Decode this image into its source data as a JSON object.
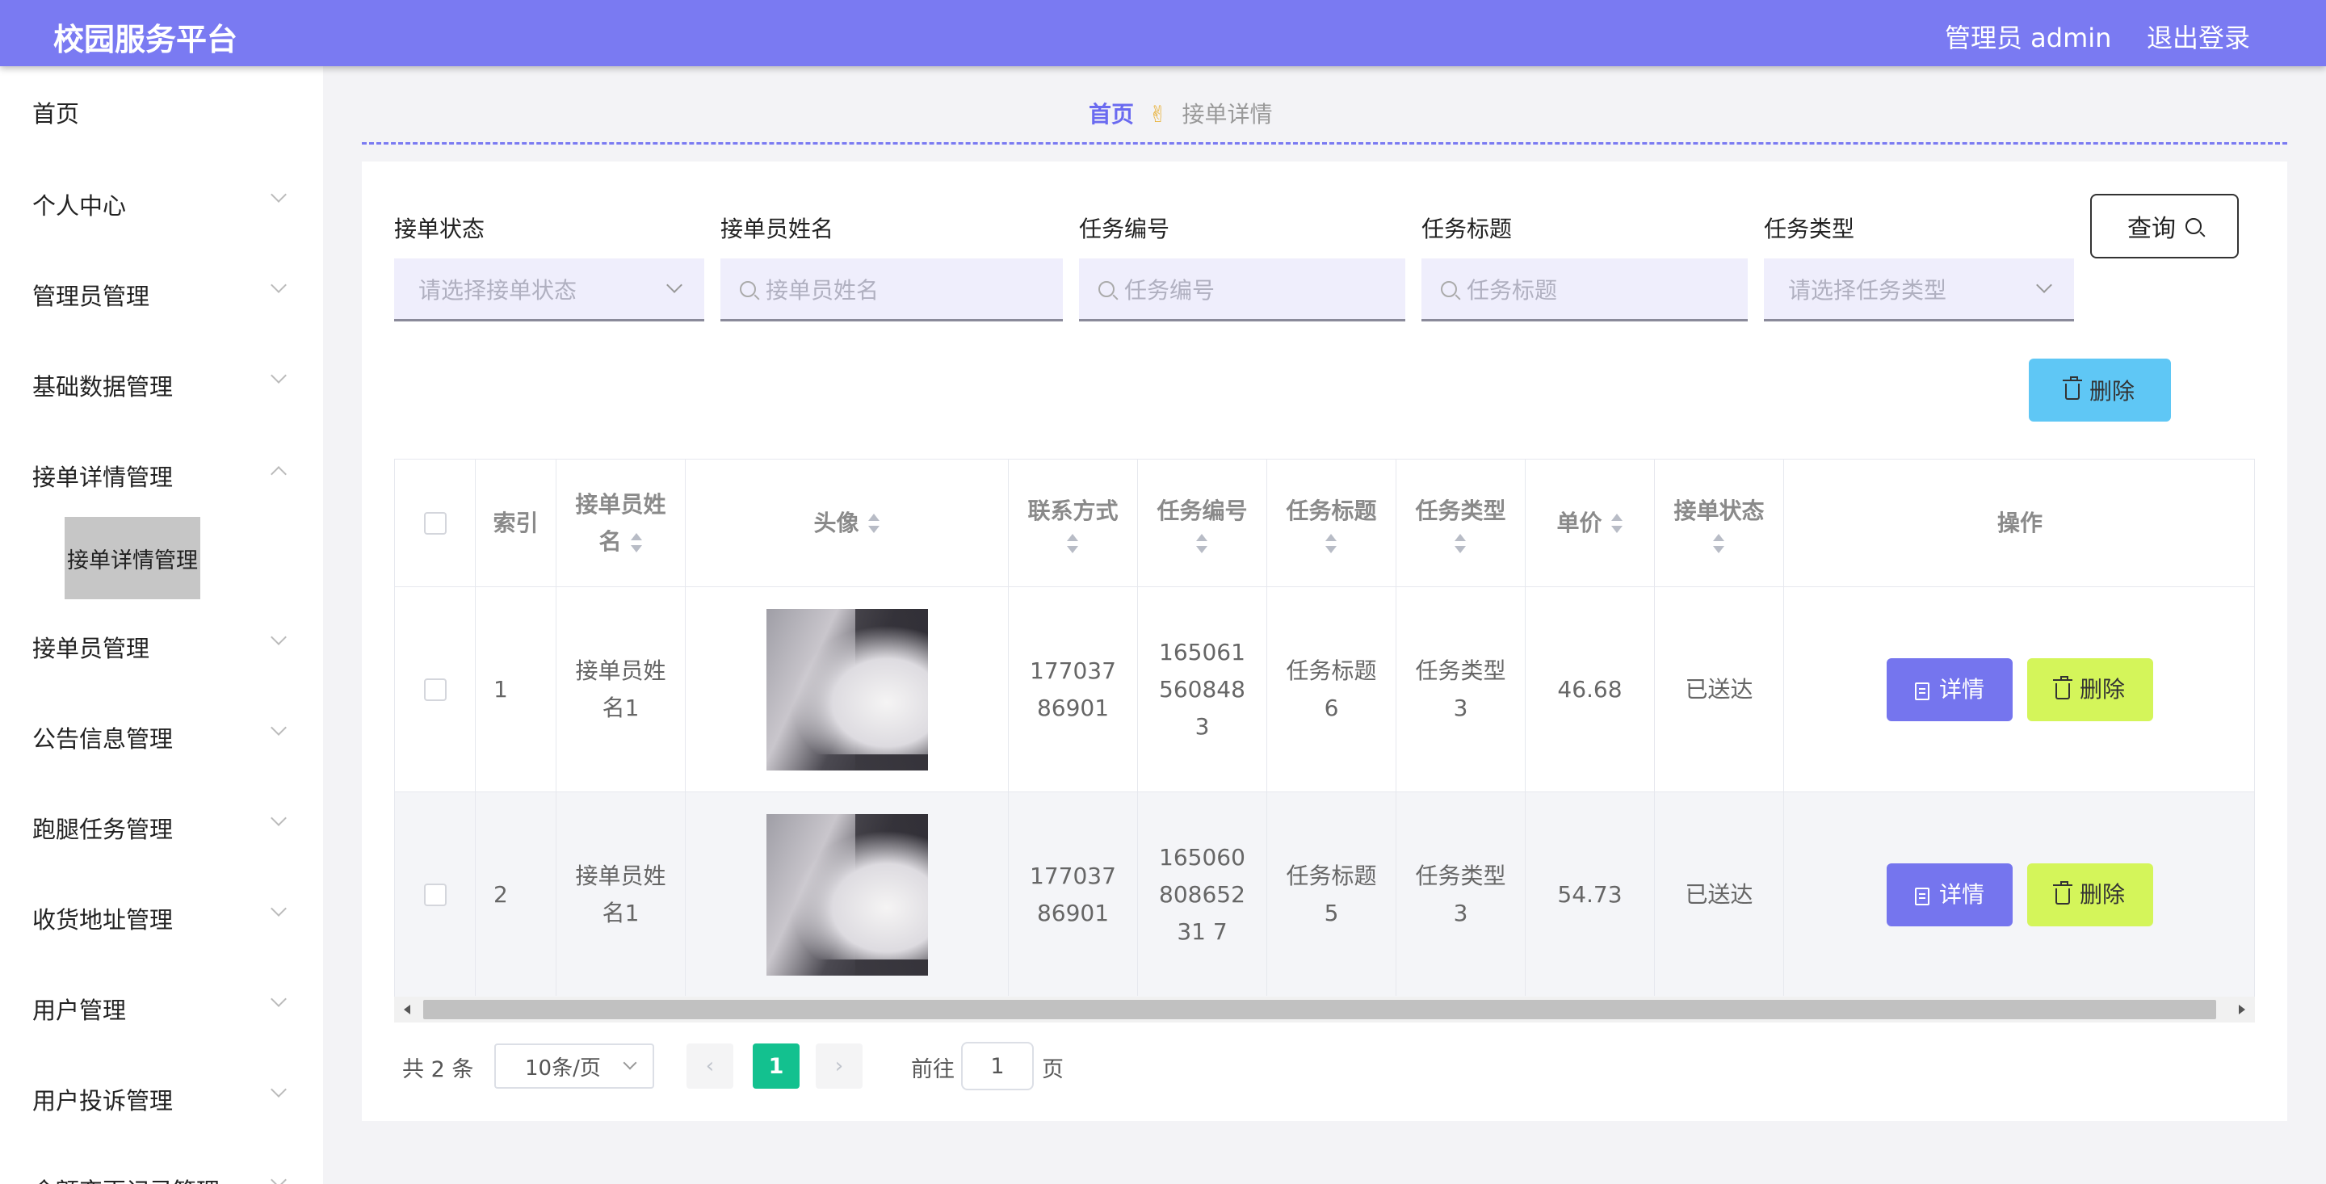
{
  "header": {
    "title": "校园服务平台",
    "admin_label": "管理员 admin",
    "logout_label": "退出登录"
  },
  "sidebar": {
    "items": [
      {
        "label": "首页"
      },
      {
        "label": "个人中心"
      },
      {
        "label": "管理员管理"
      },
      {
        "label": "基础数据管理"
      },
      {
        "label": "接单详情管理"
      },
      {
        "label": "接单员管理"
      },
      {
        "label": "公告信息管理"
      },
      {
        "label": "跑腿任务管理"
      },
      {
        "label": "收货地址管理"
      },
      {
        "label": "用户管理"
      },
      {
        "label": "用户投诉管理"
      },
      {
        "label": "余额变更记录管理"
      }
    ],
    "active_sub": "接单详情管理"
  },
  "breadcrumb": {
    "home": "首页",
    "separator": "✌",
    "current": "接单详情"
  },
  "filters": {
    "status": {
      "label": "接单状态",
      "placeholder": "请选择接单状态"
    },
    "name": {
      "label": "接单员姓名",
      "placeholder": "接单员姓名"
    },
    "task_no": {
      "label": "任务编号",
      "placeholder": "任务编号"
    },
    "task_title": {
      "label": "任务标题",
      "placeholder": "任务标题"
    },
    "task_type": {
      "label": "任务类型",
      "placeholder": "请选择任务类型"
    },
    "query_label": "查询"
  },
  "toolbar": {
    "delete_label": "删除"
  },
  "table": {
    "headers": {
      "index": "索引",
      "name_l1": "接单员姓",
      "name_l2": "名",
      "avatar": "头像",
      "phone": "联系方式",
      "task_no": "任务编号",
      "task_title": "任务标题",
      "task_type": "任务类型",
      "price": "单价",
      "status": "接单状态",
      "actions": "操作"
    },
    "rows": [
      {
        "index": "1",
        "name": "接单员姓名1",
        "phone": "17703786901",
        "task_no": "1650615608483",
        "task_title": "任务标题6",
        "task_type": "任务类型3",
        "price": "46.68",
        "status": "已送达",
        "detail": "详情",
        "delete": "删除"
      },
      {
        "index": "2",
        "name": "接单员姓名1",
        "phone": "17703786901",
        "task_no": "16506080865231 7",
        "task_title": "任务标题5",
        "task_type": "任务类型3",
        "price": "54.73",
        "status": "已送达",
        "detail": "详情",
        "delete": "删除"
      }
    ]
  },
  "pagination": {
    "total": "共 2 条",
    "page_size": "10条/页",
    "current_page": "1",
    "goto_prefix": "前往",
    "goto_value": "1",
    "goto_suffix": "页"
  },
  "colors": {
    "header": "#7a7af2",
    "accent": "#6a6af0",
    "detail_button": "#7575ee",
    "delete_button": "#d4f55a",
    "top_delete": "#5fc7f5",
    "page_active": "#13c18f"
  }
}
